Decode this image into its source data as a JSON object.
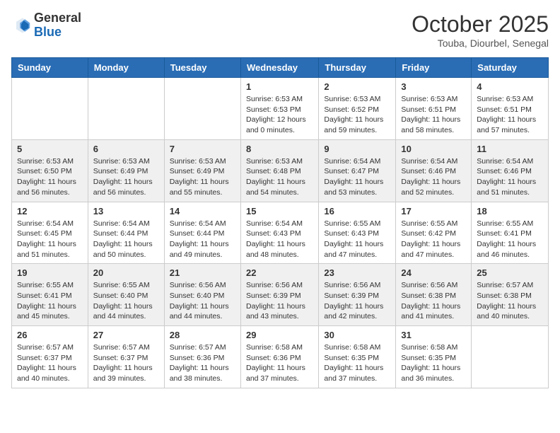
{
  "header": {
    "logo": {
      "line1": "General",
      "line2": "Blue"
    },
    "title": "October 2025",
    "location": "Touba, Diourbel, Senegal"
  },
  "calendar": {
    "weekdays": [
      "Sunday",
      "Monday",
      "Tuesday",
      "Wednesday",
      "Thursday",
      "Friday",
      "Saturday"
    ],
    "weeks": [
      [
        {
          "day": "",
          "info": ""
        },
        {
          "day": "",
          "info": ""
        },
        {
          "day": "",
          "info": ""
        },
        {
          "day": "1",
          "info": "Sunrise: 6:53 AM\nSunset: 6:53 PM\nDaylight: 12 hours\nand 0 minutes."
        },
        {
          "day": "2",
          "info": "Sunrise: 6:53 AM\nSunset: 6:52 PM\nDaylight: 11 hours\nand 59 minutes."
        },
        {
          "day": "3",
          "info": "Sunrise: 6:53 AM\nSunset: 6:51 PM\nDaylight: 11 hours\nand 58 minutes."
        },
        {
          "day": "4",
          "info": "Sunrise: 6:53 AM\nSunset: 6:51 PM\nDaylight: 11 hours\nand 57 minutes."
        }
      ],
      [
        {
          "day": "5",
          "info": "Sunrise: 6:53 AM\nSunset: 6:50 PM\nDaylight: 11 hours\nand 56 minutes."
        },
        {
          "day": "6",
          "info": "Sunrise: 6:53 AM\nSunset: 6:49 PM\nDaylight: 11 hours\nand 56 minutes."
        },
        {
          "day": "7",
          "info": "Sunrise: 6:53 AM\nSunset: 6:49 PM\nDaylight: 11 hours\nand 55 minutes."
        },
        {
          "day": "8",
          "info": "Sunrise: 6:53 AM\nSunset: 6:48 PM\nDaylight: 11 hours\nand 54 minutes."
        },
        {
          "day": "9",
          "info": "Sunrise: 6:54 AM\nSunset: 6:47 PM\nDaylight: 11 hours\nand 53 minutes."
        },
        {
          "day": "10",
          "info": "Sunrise: 6:54 AM\nSunset: 6:46 PM\nDaylight: 11 hours\nand 52 minutes."
        },
        {
          "day": "11",
          "info": "Sunrise: 6:54 AM\nSunset: 6:46 PM\nDaylight: 11 hours\nand 51 minutes."
        }
      ],
      [
        {
          "day": "12",
          "info": "Sunrise: 6:54 AM\nSunset: 6:45 PM\nDaylight: 11 hours\nand 51 minutes."
        },
        {
          "day": "13",
          "info": "Sunrise: 6:54 AM\nSunset: 6:44 PM\nDaylight: 11 hours\nand 50 minutes."
        },
        {
          "day": "14",
          "info": "Sunrise: 6:54 AM\nSunset: 6:44 PM\nDaylight: 11 hours\nand 49 minutes."
        },
        {
          "day": "15",
          "info": "Sunrise: 6:54 AM\nSunset: 6:43 PM\nDaylight: 11 hours\nand 48 minutes."
        },
        {
          "day": "16",
          "info": "Sunrise: 6:55 AM\nSunset: 6:43 PM\nDaylight: 11 hours\nand 47 minutes."
        },
        {
          "day": "17",
          "info": "Sunrise: 6:55 AM\nSunset: 6:42 PM\nDaylight: 11 hours\nand 47 minutes."
        },
        {
          "day": "18",
          "info": "Sunrise: 6:55 AM\nSunset: 6:41 PM\nDaylight: 11 hours\nand 46 minutes."
        }
      ],
      [
        {
          "day": "19",
          "info": "Sunrise: 6:55 AM\nSunset: 6:41 PM\nDaylight: 11 hours\nand 45 minutes."
        },
        {
          "day": "20",
          "info": "Sunrise: 6:55 AM\nSunset: 6:40 PM\nDaylight: 11 hours\nand 44 minutes."
        },
        {
          "day": "21",
          "info": "Sunrise: 6:56 AM\nSunset: 6:40 PM\nDaylight: 11 hours\nand 44 minutes."
        },
        {
          "day": "22",
          "info": "Sunrise: 6:56 AM\nSunset: 6:39 PM\nDaylight: 11 hours\nand 43 minutes."
        },
        {
          "day": "23",
          "info": "Sunrise: 6:56 AM\nSunset: 6:39 PM\nDaylight: 11 hours\nand 42 minutes."
        },
        {
          "day": "24",
          "info": "Sunrise: 6:56 AM\nSunset: 6:38 PM\nDaylight: 11 hours\nand 41 minutes."
        },
        {
          "day": "25",
          "info": "Sunrise: 6:57 AM\nSunset: 6:38 PM\nDaylight: 11 hours\nand 40 minutes."
        }
      ],
      [
        {
          "day": "26",
          "info": "Sunrise: 6:57 AM\nSunset: 6:37 PM\nDaylight: 11 hours\nand 40 minutes."
        },
        {
          "day": "27",
          "info": "Sunrise: 6:57 AM\nSunset: 6:37 PM\nDaylight: 11 hours\nand 39 minutes."
        },
        {
          "day": "28",
          "info": "Sunrise: 6:57 AM\nSunset: 6:36 PM\nDaylight: 11 hours\nand 38 minutes."
        },
        {
          "day": "29",
          "info": "Sunrise: 6:58 AM\nSunset: 6:36 PM\nDaylight: 11 hours\nand 37 minutes."
        },
        {
          "day": "30",
          "info": "Sunrise: 6:58 AM\nSunset: 6:35 PM\nDaylight: 11 hours\nand 37 minutes."
        },
        {
          "day": "31",
          "info": "Sunrise: 6:58 AM\nSunset: 6:35 PM\nDaylight: 11 hours\nand 36 minutes."
        },
        {
          "day": "",
          "info": ""
        }
      ]
    ]
  }
}
